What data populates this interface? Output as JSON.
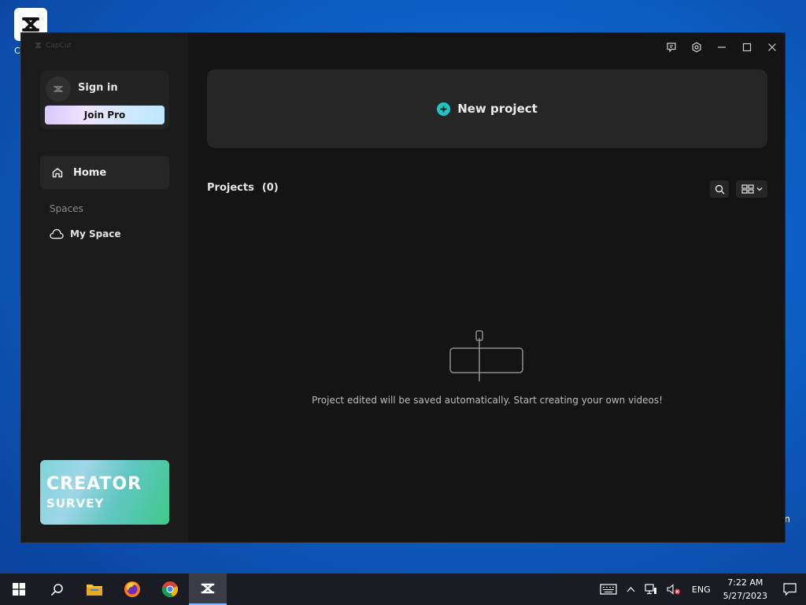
{
  "desktop": {
    "icon_caption": "C",
    "right_edge_text": "n"
  },
  "window": {
    "app_name": "CapCut"
  },
  "account": {
    "sign_in_label": "Sign in",
    "join_pro_label": "Join Pro"
  },
  "nav": {
    "home_label": "Home",
    "spaces_heading": "Spaces",
    "my_space_label": "My Space"
  },
  "survey": {
    "line1": "CREATOR",
    "line2": "SURVEY"
  },
  "main": {
    "new_project_label": "New project",
    "projects_label": "Projects",
    "projects_count": "(0)",
    "empty_message": "Project edited will be saved automatically. Start creating your own videos!"
  },
  "taskbar": {
    "language": "ENG",
    "time": "7:22 AM",
    "date": "5/27/2023"
  },
  "colors": {
    "accent": "#1fc6c6",
    "window_bg": "#141414",
    "sidebar_bg": "#1b1b1b",
    "card_bg": "#262626"
  }
}
